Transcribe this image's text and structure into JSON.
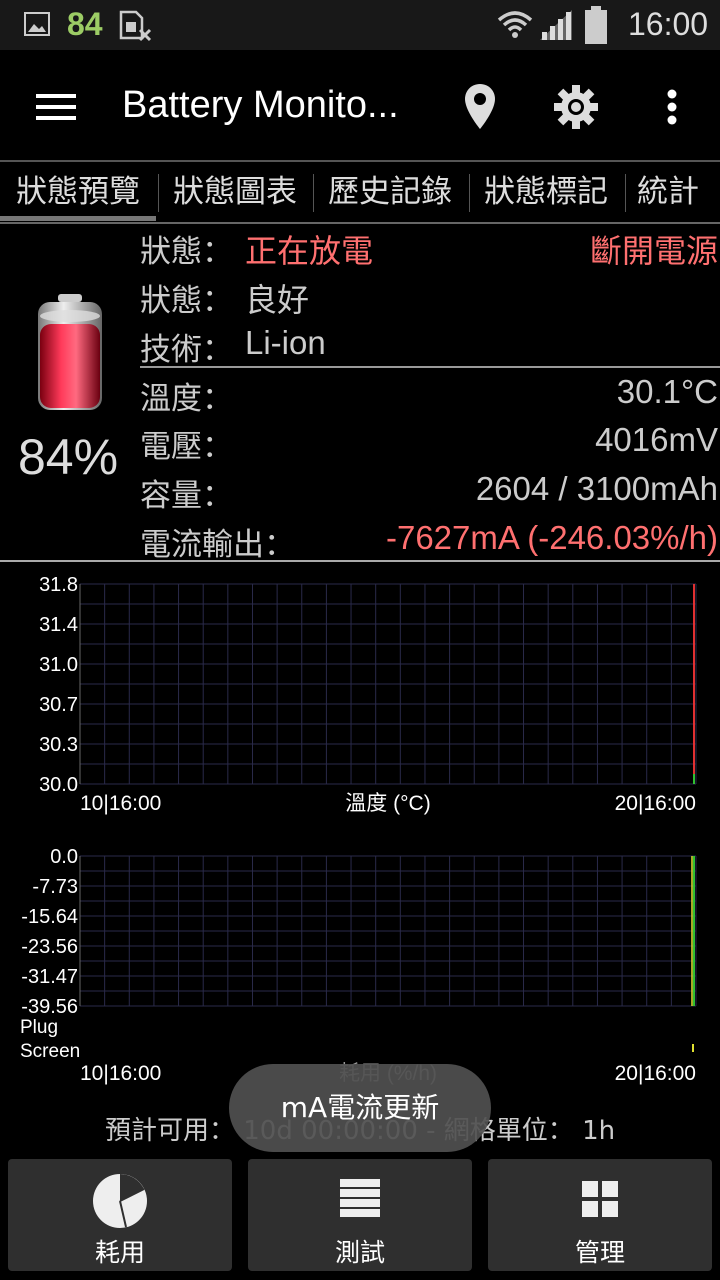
{
  "status_bar": {
    "battery_badge": "84",
    "time": "16:00"
  },
  "action_bar": {
    "title": "Battery Monito..."
  },
  "tabs": [
    {
      "label": "狀態預覽"
    },
    {
      "label": "狀態圖表"
    },
    {
      "label": "歷史記錄"
    },
    {
      "label": "狀態標記"
    },
    {
      "label": "統計"
    }
  ],
  "battery": {
    "percent": "84%",
    "level": 0.84
  },
  "info": {
    "status_label": "狀態：",
    "status_value": "正在放電",
    "plug_state": "斷開電源",
    "health_label": "狀態：",
    "health_value": "良好",
    "tech_label": "技術：",
    "tech_value": "Li-ion",
    "temp_label": "溫度：",
    "temp_value": "30.1°C",
    "voltage_label": "電壓：",
    "voltage_value": "4016mV",
    "capacity_label": "容量：",
    "capacity_value": "2604 / 3100mAh",
    "current_label": "電流輸出：",
    "current_value": "-7627mA (-246.03%/h)"
  },
  "chart_data": [
    {
      "type": "line",
      "title": "溫度 (°C)",
      "yticks": [
        "31.8",
        "31.4",
        "31.0",
        "30.7",
        "30.3",
        "30.0"
      ],
      "ylim": [
        30.0,
        31.8
      ],
      "xticks": [
        "10|16:00",
        "20|16:00"
      ],
      "series": [
        {
          "values": [
            31.8,
            30.0
          ]
        }
      ]
    },
    {
      "type": "line",
      "title": "耗用 (%/h)",
      "yticks": [
        "0.0",
        "-7.73",
        "-15.64",
        "-23.56",
        "-31.47",
        "-39.56"
      ],
      "ylim": [
        -39.56,
        0.0
      ],
      "row_labels": [
        "Plug",
        "Screen"
      ],
      "xticks": [
        "10|16:00",
        "20|16:00"
      ],
      "series": [
        {
          "values": [
            0.0,
            -39.56
          ]
        }
      ]
    }
  ],
  "estimate": {
    "text": "預計可用： 10d 00:00:00 - 網格單位： 1h"
  },
  "toast": {
    "text": "mA電流更新"
  },
  "bottom_buttons": [
    {
      "label": "耗用"
    },
    {
      "label": "測試"
    },
    {
      "label": "管理"
    }
  ],
  "colors": {
    "discharge_red": "#ff7070",
    "grid": "#2a2a4a",
    "button_bg": "#2f2f2f"
  }
}
